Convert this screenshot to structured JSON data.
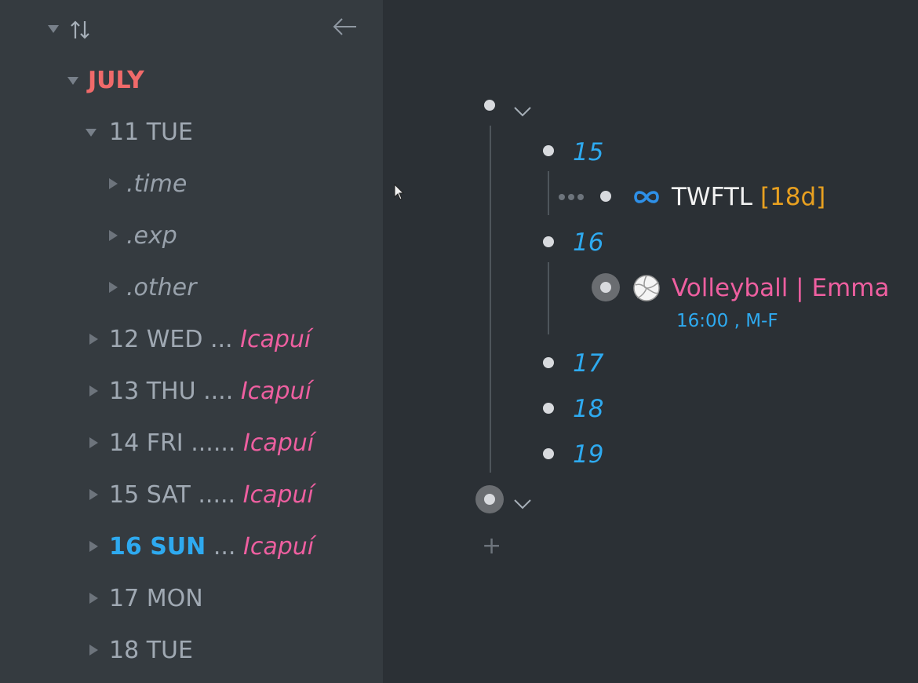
{
  "sidebar": {
    "month_label": "JULY",
    "days": [
      {
        "label": "11 TUE",
        "expanded": true
      },
      {
        "label": "12 WED",
        "dots": "...",
        "location": "Icapuí"
      },
      {
        "label": "13 THU",
        "dots": "....",
        "location": "Icapuí"
      },
      {
        "label": "14 FRI",
        "dots": "......",
        "location": "Icapuí"
      },
      {
        "label": "15 SAT",
        "dots": ".....",
        "location": "Icapuí"
      },
      {
        "label": "16 SUN",
        "dots": "...",
        "location": "Icapuí",
        "today": true
      },
      {
        "label": "17 MON"
      },
      {
        "label": "18 TUE"
      }
    ],
    "subitems": [
      ".time",
      ".exp",
      ".other"
    ]
  },
  "main": {
    "dates": [
      "15",
      "16",
      "17",
      "18",
      "19"
    ],
    "habit": {
      "title": "TWFTL",
      "badge": "[18d]"
    },
    "event": {
      "title": "Volleyball | Emma",
      "meta": "16:00 , M-F"
    },
    "add_symbol": "+"
  },
  "colors": {
    "accent_blue": "#2eaaf0",
    "pink": "#ee5fa0",
    "red_month": "#f06a6a",
    "orange_badge": "#e8a020",
    "sidebar_bg": "#353b40",
    "main_bg": "#2b3035"
  }
}
